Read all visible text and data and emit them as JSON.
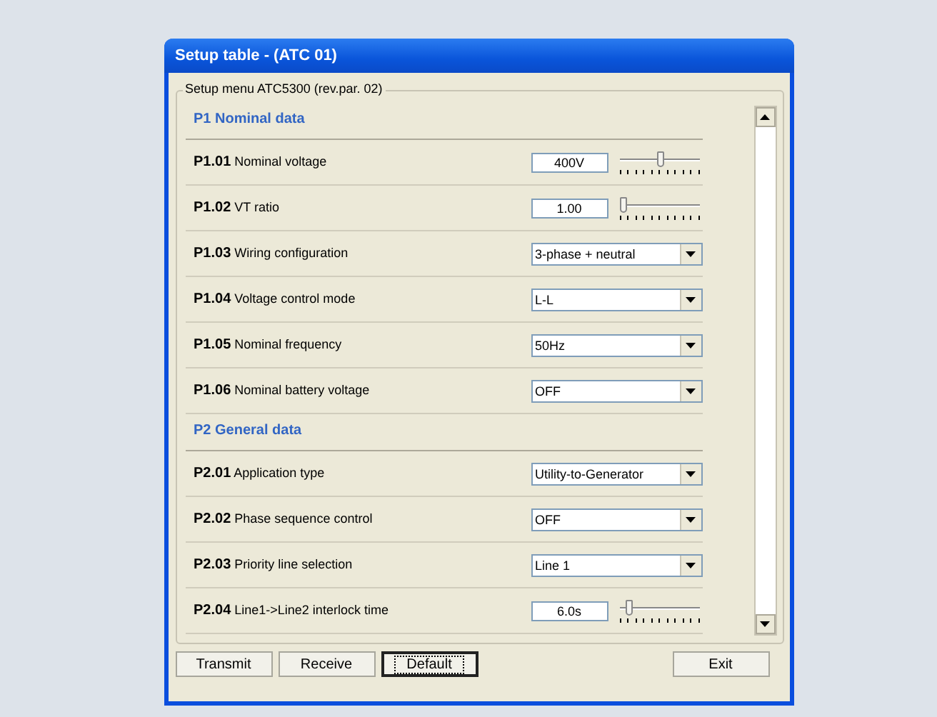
{
  "window": {
    "title": "Setup table - (ATC 01)"
  },
  "group": {
    "title": "Setup menu ATC5300 (rev.par. 02)"
  },
  "sections": [
    {
      "title": "P1 Nominal data",
      "rows": [
        {
          "code": "P1.01",
          "label": "Nominal voltage",
          "kind": "slider",
          "value": "400V",
          "level": 0.55
        },
        {
          "code": "P1.02",
          "label": "VT ratio",
          "kind": "slider",
          "value": "1.00",
          "level": 0.04
        },
        {
          "code": "P1.03",
          "label": "Wiring configuration",
          "kind": "dropdown",
          "value": "3-phase + neutral"
        },
        {
          "code": "P1.04",
          "label": "Voltage control mode",
          "kind": "dropdown",
          "value": "L-L"
        },
        {
          "code": "P1.05",
          "label": "Nominal frequency",
          "kind": "dropdown",
          "value": "50Hz"
        },
        {
          "code": "P1.06",
          "label": "Nominal battery voltage",
          "kind": "dropdown",
          "value": "OFF"
        }
      ]
    },
    {
      "title": "P2 General data",
      "rows": [
        {
          "code": "P2.01",
          "label": "Application type",
          "kind": "dropdown",
          "value": "Utility-to-Generator"
        },
        {
          "code": "P2.02",
          "label": "Phase sequence control",
          "kind": "dropdown",
          "value": "OFF"
        },
        {
          "code": "P2.03",
          "label": "Priority line selection",
          "kind": "dropdown",
          "value": "Line 1"
        },
        {
          "code": "P2.04",
          "label": "Line1->Line2 interlock time",
          "kind": "slider",
          "value": "6.0s",
          "level": 0.12
        }
      ]
    }
  ],
  "buttons": [
    {
      "label": "Transmit",
      "focused": false
    },
    {
      "label": "Receive",
      "focused": false
    },
    {
      "label": "Default",
      "focused": true
    },
    {
      "label": "Exit",
      "focused": false
    }
  ]
}
